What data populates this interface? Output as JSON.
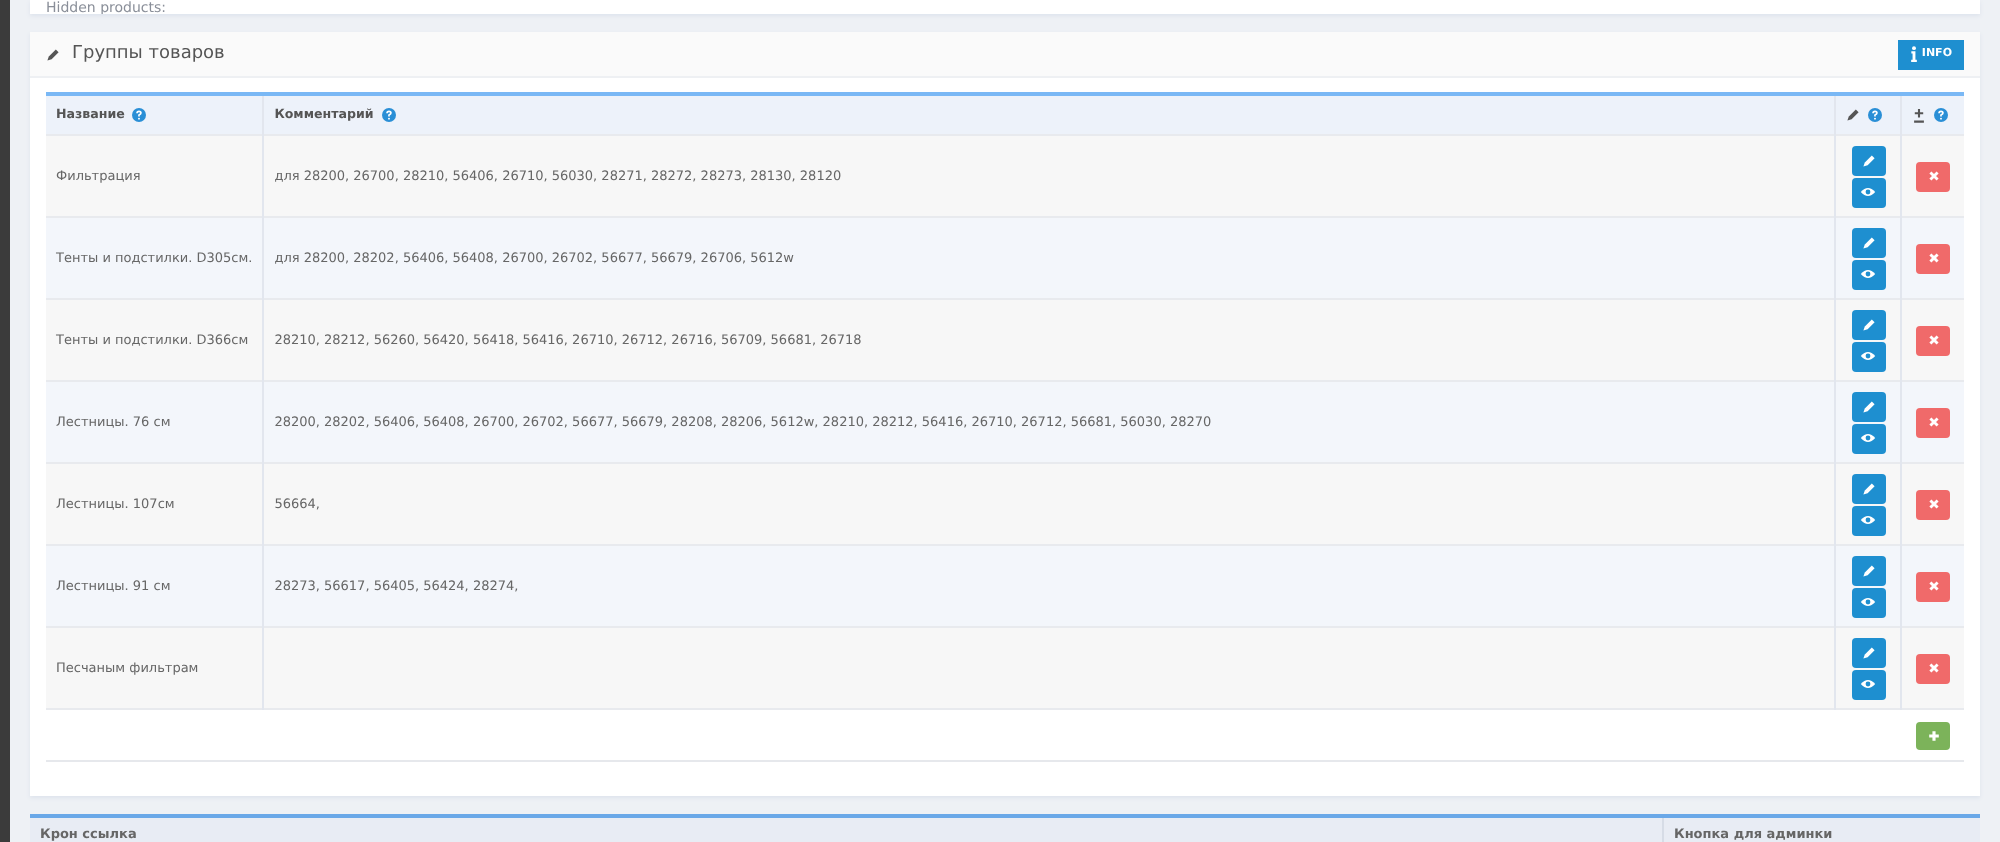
{
  "hidden_panel": {
    "text": "Hidden products:"
  },
  "groups_panel": {
    "title": "Группы товаров",
    "info_button": "INFO",
    "table": {
      "columns": [
        "Название",
        "Комментарий"
      ],
      "rows": [
        {
          "name": "Фильтрация",
          "comment": "для 28200, 26700, 28210, 56406, 26710, 56030, 28271, 28272, 28273, 28130, 28120"
        },
        {
          "name": "Тенты и подстилки. D305см.",
          "comment": "для 28200, 28202, 56406, 56408, 26700, 26702, 56677, 56679, 26706, 5612w"
        },
        {
          "name": "Тенты и подстилки. D366см",
          "comment": "28210, 28212, 56260, 56420, 56418, 56416, 26710, 26712, 26716, 56709, 56681, 26718"
        },
        {
          "name": "Лестницы. 76 см",
          "comment": "28200, 28202, 56406, 56408, 26700, 26702, 56677, 56679, 28208, 28206, 5612w, 28210, 28212, 56416, 26710, 26712, 56681, 56030, 28270"
        },
        {
          "name": "Лестницы. 107см",
          "comment": "56664,"
        },
        {
          "name": "Лестницы. 91 см",
          "comment": "28273, 56617, 56405, 56424, 28274,"
        },
        {
          "name": "Песчаным фильтрам"
        }
      ]
    }
  },
  "cron_panel": {
    "columns": [
      "Крон ссылка",
      "Кнопка для админки"
    ]
  }
}
